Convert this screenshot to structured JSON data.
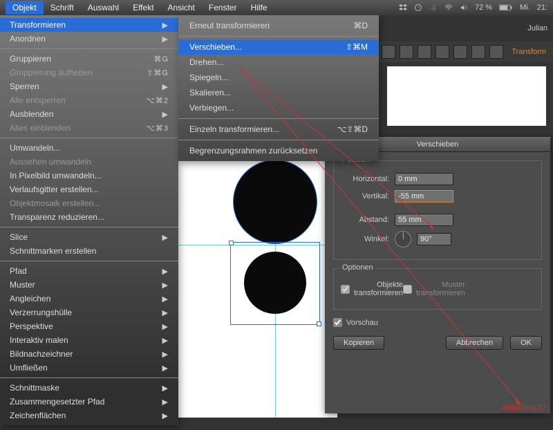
{
  "menubar": {
    "items": [
      "Objekt",
      "Schrift",
      "Auswahl",
      "Effekt",
      "Ansicht",
      "Fenster",
      "Hilfe"
    ],
    "active": 0
  },
  "sys": {
    "battery": "72 %",
    "day": "Mi.",
    "time": "21:",
    "user": "Julian"
  },
  "dropdown": {
    "groups": [
      [
        {
          "l": "Transformieren",
          "sc": "",
          "sub": true,
          "hl": true
        },
        {
          "l": "Anordnen",
          "sc": "",
          "sub": true
        }
      ],
      [
        {
          "l": "Gruppieren",
          "sc": "⌘G"
        },
        {
          "l": "Gruppierung aufheben",
          "sc": "⇧⌘G",
          "dis": true
        },
        {
          "l": "Sperren",
          "sc": "",
          "sub": true
        },
        {
          "l": "Alle entsperren",
          "sc": "⌥⌘2",
          "dis": true
        },
        {
          "l": "Ausblenden",
          "sc": "",
          "sub": true
        },
        {
          "l": "Alles einblenden",
          "sc": "⌥⌘3",
          "dis": true
        }
      ],
      [
        {
          "l": "Umwandeln..."
        },
        {
          "l": "Aussehen umwandeln",
          "dis": true
        },
        {
          "l": "In Pixelbild umwandeln..."
        },
        {
          "l": "Verlaufsgitter erstellen..."
        },
        {
          "l": "Objektmosaik erstellen...",
          "dis": true
        },
        {
          "l": "Transparenz reduzieren..."
        }
      ],
      [
        {
          "l": "Slice",
          "sub": true
        },
        {
          "l": "Schnittmarken erstellen"
        }
      ],
      [
        {
          "l": "Pfad",
          "sub": true
        },
        {
          "l": "Muster",
          "sub": true
        },
        {
          "l": "Angleichen",
          "sub": true
        },
        {
          "l": "Verzerrungshülle",
          "sub": true
        },
        {
          "l": "Perspektive",
          "sub": true
        },
        {
          "l": "Interaktiv malen",
          "sub": true
        },
        {
          "l": "Bildnachzeichner",
          "sub": true
        },
        {
          "l": "Umfließen",
          "sub": true
        }
      ],
      [
        {
          "l": "Schnittmaske",
          "sub": true
        },
        {
          "l": "Zusammengesetzter Pfad",
          "sub": true
        },
        {
          "l": "Zeichenflächen",
          "sub": true
        }
      ]
    ]
  },
  "submenu": {
    "items": [
      {
        "l": "Erneut transformieren",
        "sc": "⌘D"
      },
      null,
      {
        "l": "Verschieben...",
        "sc": "⇧⌘M",
        "hl": true
      },
      {
        "l": "Drehen..."
      },
      {
        "l": "Spiegeln..."
      },
      {
        "l": "Skalieren..."
      },
      {
        "l": "Verbiegen..."
      },
      null,
      {
        "l": "Einzeln transformieren...",
        "sc": "⌥⇧⌘D"
      },
      null,
      {
        "l": "Begrenzungsrahmen zurücksetzen"
      }
    ]
  },
  "toolbar2": {
    "tab": "Transform"
  },
  "dialog": {
    "title": "Verschieben",
    "position": {
      "legend": "Position",
      "horizontal_l": "Horizontal:",
      "horizontal_v": "0 mm",
      "vertical_l": "Vertikal:",
      "vertical_v": "-55 mm",
      "abstand_l": "Abstand:",
      "abstand_v": "55 mm",
      "winkel_l": "Winkel:",
      "winkel_v": "90°"
    },
    "options": {
      "legend": "Optionen",
      "transform_obj": "Objekte transformieren",
      "transform_pat": "Muster transformieren"
    },
    "preview": "Vorschau",
    "btn_copy": "Kopieren",
    "btn_cancel": "Abbrechen",
    "btn_ok": "OK"
  },
  "annotation": "Abbildung 17"
}
